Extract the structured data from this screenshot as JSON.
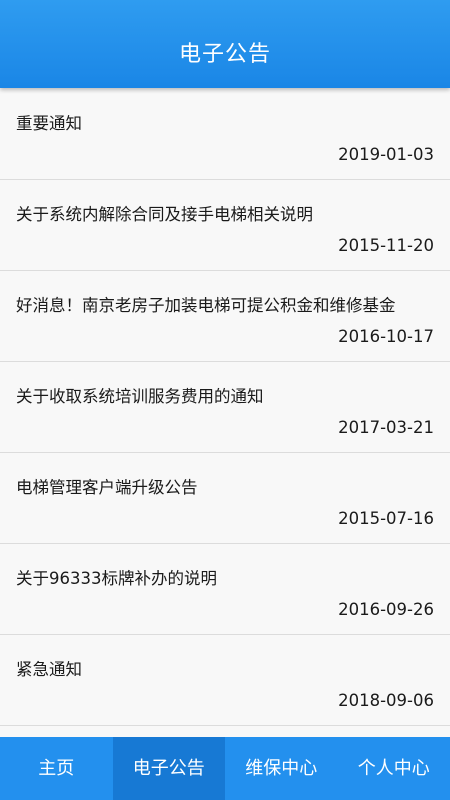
{
  "header": {
    "title": "电子公告"
  },
  "announcements": [
    {
      "title": "重要通知",
      "date": "2019-01-03"
    },
    {
      "title": "关于系统内解除合同及接手电梯相关说明",
      "date": "2015-11-20"
    },
    {
      "title": "好消息！南京老房子加装电梯可提公积金和维修基金",
      "date": "2016-10-17"
    },
    {
      "title": "关于收取系统培训服务费用的通知",
      "date": "2017-03-21"
    },
    {
      "title": "电梯管理客户端升级公告",
      "date": "2015-07-16"
    },
    {
      "title": "关于96333标牌补办的说明",
      "date": "2016-09-26"
    },
    {
      "title": "紧急通知",
      "date": "2018-09-06"
    }
  ],
  "tabbar": {
    "items": [
      {
        "label": "主页"
      },
      {
        "label": "电子公告"
      },
      {
        "label": "维保中心"
      },
      {
        "label": "个人中心"
      }
    ],
    "active_index": 1
  },
  "colors": {
    "header": "#1a86e6",
    "tabbar": "#2390ee",
    "tab_active": "#1779d4",
    "background": "#f8f8f8"
  }
}
